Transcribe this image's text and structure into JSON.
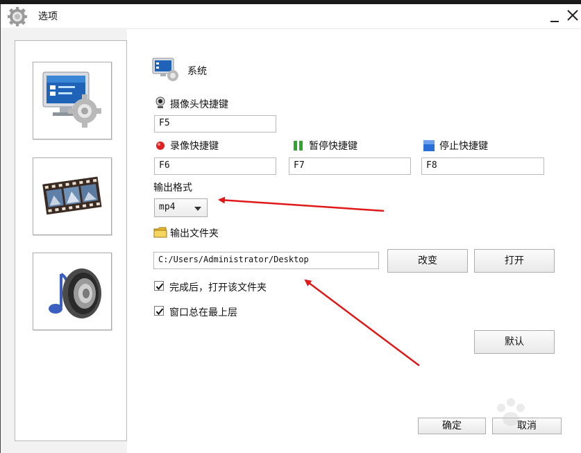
{
  "window": {
    "title": "选项"
  },
  "sidebar": {
    "items": [
      {
        "icon": "system-monitor-gear-icon"
      },
      {
        "icon": "film-strip-icon"
      },
      {
        "icon": "speaker-music-icon"
      }
    ]
  },
  "section": {
    "title": "系统",
    "icon": "monitor-gear-icon"
  },
  "hotkeys": {
    "camera": {
      "label": "摄像头快捷键",
      "value": "F5",
      "icon": "webcam-icon"
    },
    "record": {
      "label": "录像快捷键",
      "value": "F6",
      "icon": "record-dot-icon"
    },
    "pause": {
      "label": "暂停快捷键",
      "value": "F7",
      "icon": "pause-icon"
    },
    "stop": {
      "label": "停止快捷键",
      "value": "F8",
      "icon": "stop-square-icon"
    }
  },
  "output_format": {
    "label": "输出格式",
    "selected": "mp4"
  },
  "output_folder": {
    "label": "输出文件夹",
    "path": "C:/Users/Administrator/Desktop",
    "change_label": "改变",
    "open_label": "打开",
    "icon": "folder-icon"
  },
  "options": {
    "open_after": {
      "label": "完成后，打开该文件夹",
      "checked": true
    },
    "always_top": {
      "label": "窗口总在最上层",
      "checked": true
    }
  },
  "buttons": {
    "default": "默认",
    "ok": "确定",
    "cancel": "取消"
  },
  "colors": {
    "annotation_arrow": "#e01818",
    "record": "#e02020",
    "pause": "#2aa82a",
    "stop": "#2a6fd8"
  }
}
